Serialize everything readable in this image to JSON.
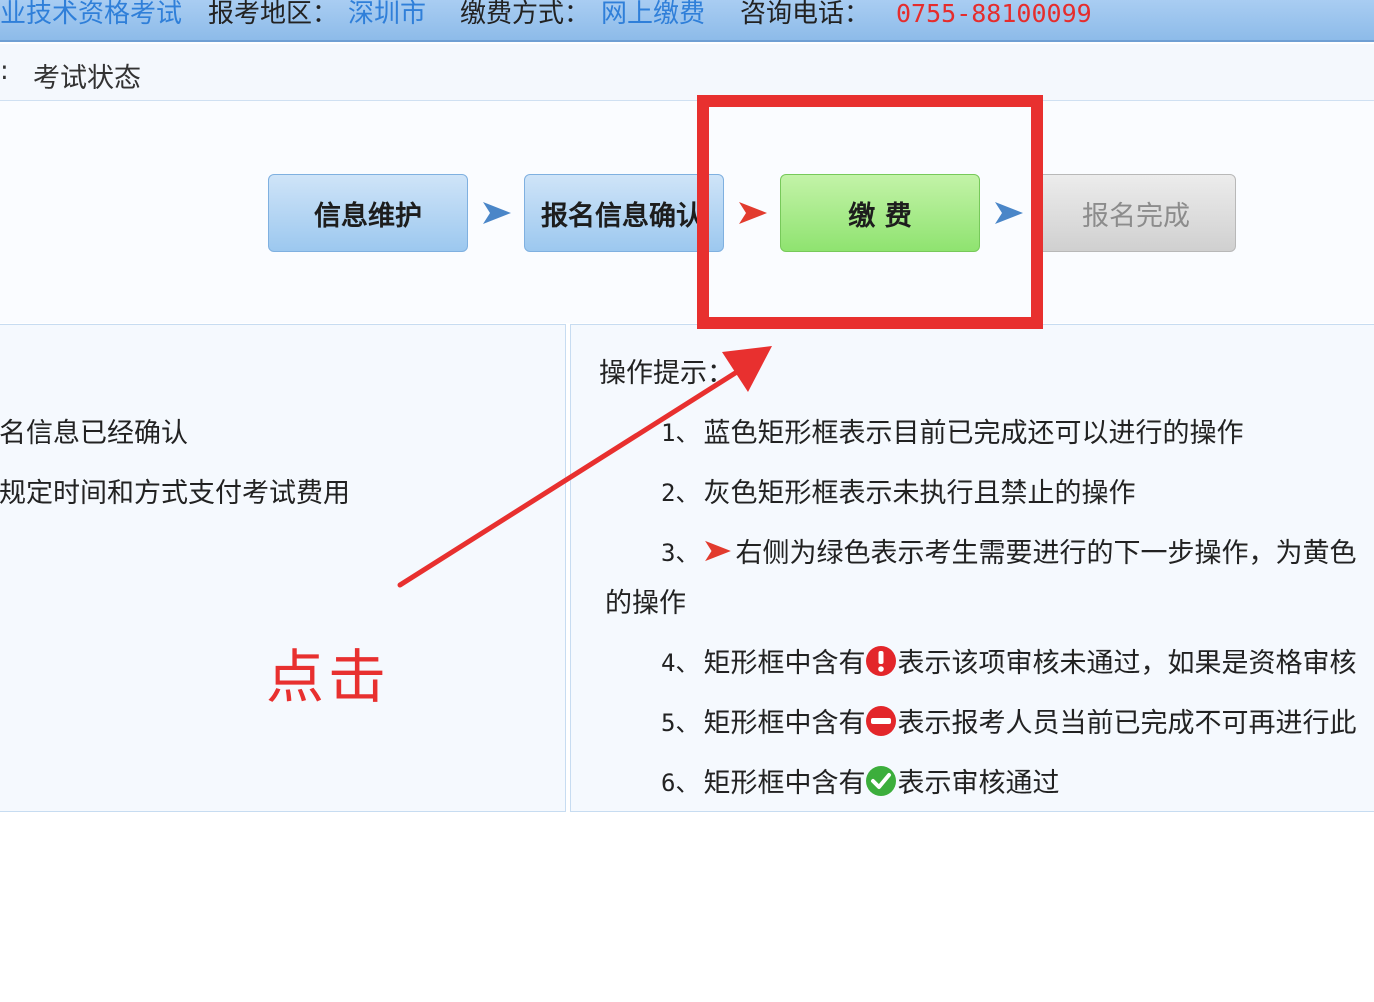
{
  "header": {
    "exam_label": "业技术资格考试",
    "region_label": "报考地区：",
    "region_value": "深圳市",
    "payment_label": "缴费方式：",
    "payment_value": "网上缴费",
    "phone_label": "咨询电话：",
    "phone_value": "0755-88100099"
  },
  "status": {
    "colon": ":",
    "title": "考试状态"
  },
  "steps": [
    {
      "label": "信息维护",
      "state": "completed-editable",
      "color": "#9cc8ef"
    },
    {
      "label": "报名信息确认",
      "state": "completed-editable",
      "color": "#9cc8ef"
    },
    {
      "label": "缴 费",
      "state": "next-step",
      "color": "#8fe370"
    },
    {
      "label": "报名完成",
      "state": "disabled",
      "color": "#d0d0d0"
    }
  ],
  "arrows": {
    "blue": "#4a86c8",
    "red": "#e23b2e"
  },
  "left_panel": {
    "line1": "名信息已经确认",
    "line2": "规定时间和方式支付考试费用"
  },
  "tips": {
    "heading": "操作提示：",
    "items": [
      {
        "num": "1、",
        "text": "蓝色矩形框表示目前已完成还可以进行的操作"
      },
      {
        "num": "2、",
        "text": "灰色矩形框表示未执行且禁止的操作"
      },
      {
        "num": "3、",
        "icon": "red-arrow-icon",
        "text": "右侧为绿色表示考生需要进行的下一步操作，为黄色",
        "continuation": "的操作"
      },
      {
        "num": "4、",
        "pre": "矩形框中含有",
        "icon": "exclamation-icon",
        "text": "表示该项审核未通过，如果是资格审核"
      },
      {
        "num": "5、",
        "pre": "矩形框中含有",
        "icon": "minus-icon",
        "text": "表示报考人员当前已完成不可再进行此"
      },
      {
        "num": "6、",
        "pre": "矩形框中含有",
        "icon": "check-icon",
        "text": "表示审核通过"
      }
    ]
  },
  "annotation": {
    "text": "点击",
    "color": "#e8302f"
  }
}
